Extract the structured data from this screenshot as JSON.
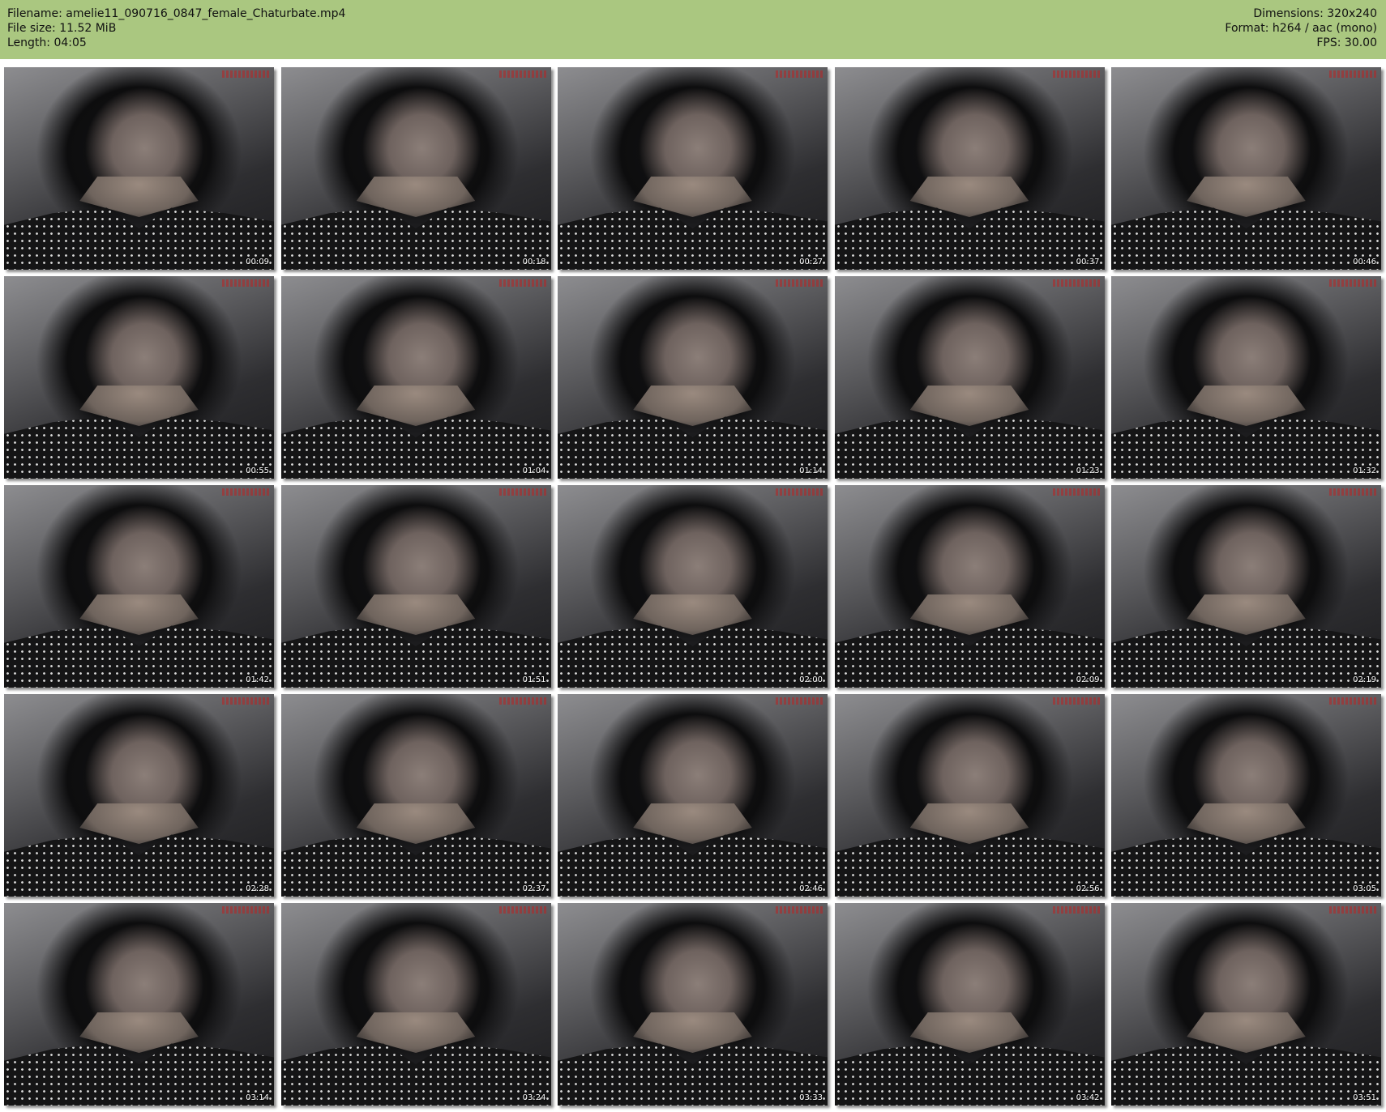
{
  "header": {
    "filename_label": "Filename: amelie11_090716_0847_female_Chaturbate.mp4",
    "filesize_label": "File size: 11.52 MiB",
    "length_label": "Length: 04:05",
    "dimensions_label": "Dimensions: 320x240",
    "format_label": "Format: h264 / aac (mono)",
    "fps_label": "FPS: 30.00",
    "background_color": "#aac780"
  },
  "thumbnails": [
    {
      "timestamp": "00:09"
    },
    {
      "timestamp": "00:18"
    },
    {
      "timestamp": "00:27"
    },
    {
      "timestamp": "00:37"
    },
    {
      "timestamp": "00:46"
    },
    {
      "timestamp": "00:55"
    },
    {
      "timestamp": "01:04"
    },
    {
      "timestamp": "01:14"
    },
    {
      "timestamp": "01:23"
    },
    {
      "timestamp": "01:32"
    },
    {
      "timestamp": "01:42"
    },
    {
      "timestamp": "01:51"
    },
    {
      "timestamp": "02:00"
    },
    {
      "timestamp": "02:09"
    },
    {
      "timestamp": "02:19"
    },
    {
      "timestamp": "02:28"
    },
    {
      "timestamp": "02:37"
    },
    {
      "timestamp": "02:46"
    },
    {
      "timestamp": "02:56"
    },
    {
      "timestamp": "03:05"
    },
    {
      "timestamp": "03:14"
    },
    {
      "timestamp": "03:24"
    },
    {
      "timestamp": "03:33"
    },
    {
      "timestamp": "03:42"
    },
    {
      "timestamp": "03:51"
    }
  ]
}
